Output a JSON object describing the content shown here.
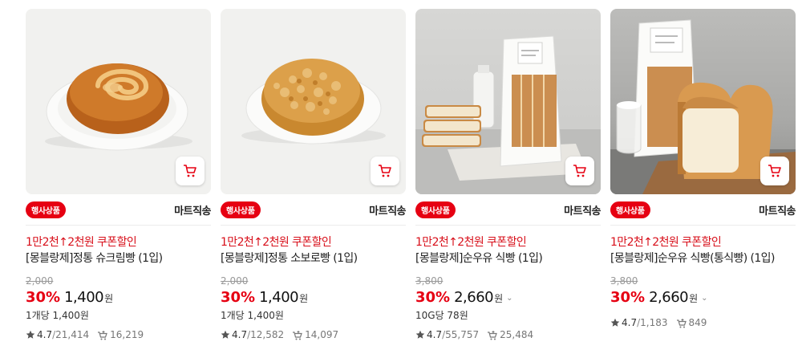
{
  "colors": {
    "accent": "#e60012",
    "promo": "#d8101b"
  },
  "products": [
    {
      "badge": "행사상품",
      "delivery": "마트직송",
      "promo": "1만2천↑2천원 쿠폰할인",
      "title": "[몽블랑제]정통 슈크림빵 (1입)",
      "original_price": "2,000",
      "discount": "30%",
      "price": "1,400",
      "won": "원",
      "unit_price": "1개당 1,400원",
      "rating": "4.7",
      "review_count": "21,414",
      "purchases": "16,219",
      "image": "cream-bun-swirl"
    },
    {
      "badge": "행사상품",
      "delivery": "마트직송",
      "promo": "1만2천↑2천원 쿠폰할인",
      "title": "[몽블랑제]정통 소보로빵 (1입)",
      "original_price": "2,000",
      "discount": "30%",
      "price": "1,400",
      "won": "원",
      "unit_price": "1개당 1,400원",
      "rating": "4.7",
      "review_count": "12,582",
      "purchases": "14,097",
      "image": "soboro-crumble-bun"
    },
    {
      "badge": "행사상품",
      "delivery": "마트직송",
      "promo": "1만2천↑2천원 쿠폰할인",
      "title": "[몽블랑제]순우유 식빵 (1입)",
      "original_price": "3,800",
      "discount": "30%",
      "price": "2,660",
      "won": "원",
      "unit_price": "10G당 78원",
      "rating": "4.7",
      "review_count": "55,757",
      "purchases": "25,484",
      "image": "sliced-milk-bread-bag"
    },
    {
      "badge": "행사상품",
      "delivery": "마트직송",
      "promo": "1만2천↑2천원 쿠폰할인",
      "title": "[몽블랑제]순우유 식빵(통식빵) (1입)",
      "original_price": "3,800",
      "discount": "30%",
      "price": "2,660",
      "won": "원",
      "unit_price": "",
      "rating": "4.7",
      "review_count": "1,183",
      "purchases": "849",
      "image": "whole-milk-bread-loaf"
    }
  ]
}
